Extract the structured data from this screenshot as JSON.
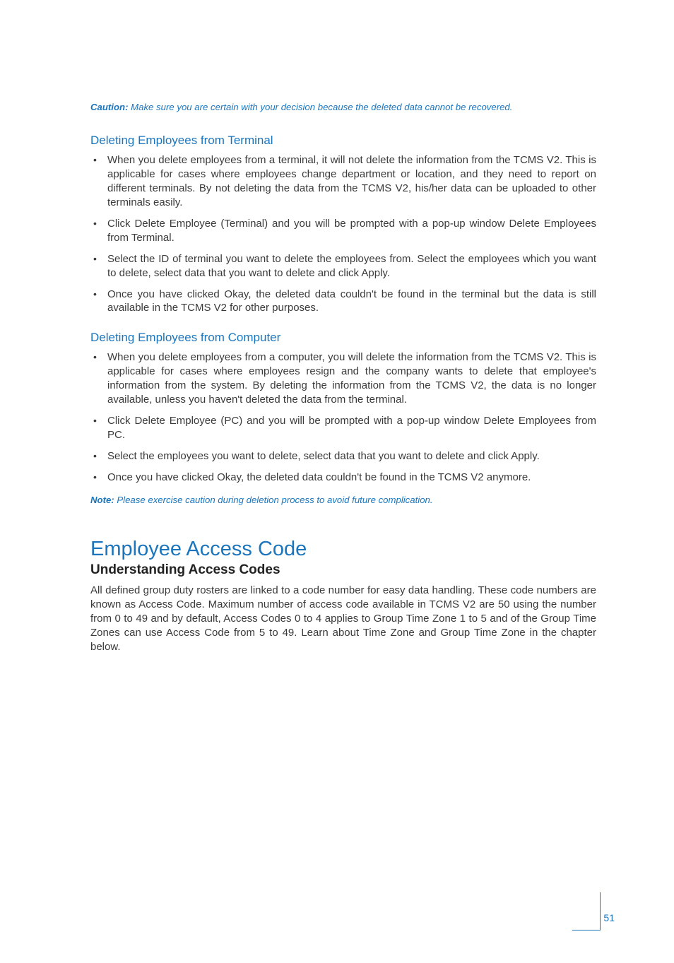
{
  "caution": {
    "label": "Caution:",
    "text": " Make sure you are certain with your decision because the deleted data cannot be recovered."
  },
  "section1": {
    "title": "Deleting Employees from Terminal",
    "items": [
      "When you delete employees from a terminal, it will not delete the information from the TCMS V2. This is applicable for cases where employees change department or location, and they need to report on different terminals. By not deleting the data from the TCMS V2, his/her data can be uploaded to other terminals easily.",
      "Click Delete Employee (Terminal) and you will be prompted with a pop-up window Delete Employees from Terminal.",
      "Select the ID of terminal you want to delete the employees from. Select the employees which you want to delete, select data that you want to delete and click Apply.",
      "Once you have clicked Okay, the deleted data couldn't be found in the terminal but the data is still available in the TCMS V2 for other purposes."
    ]
  },
  "section2": {
    "title": "Deleting Employees from Computer",
    "items": [
      "When you delete employees from a computer, you will delete the information from the TCMS V2. This is applicable for cases where employees resign and the company wants to delete that employee's information from the system. By deleting the information from the TCMS V2, the data is no longer available, unless you haven't deleted the data from the terminal.",
      "Click Delete Employee (PC) and you will be prompted with a pop-up window Delete Employees from PC.",
      "Select the employees you want to delete, select data that you want to delete and click Apply.",
      "Once you have clicked Okay, the deleted data couldn't be found in the TCMS V2 anymore."
    ]
  },
  "note": {
    "label": "Note:",
    "text": " Please exercise caution during deletion process to avoid future complication."
  },
  "main": {
    "h1": "Employee Access Code",
    "h2": "Understanding Access Codes",
    "para": "All defined group duty rosters are linked to a code number for easy data handling. These code numbers are known as Access Code. Maximum number of access code available in TCMS V2 are 50 using the number from 0 to 49 and by default, Access Codes 0 to 4 applies to Group Time Zone 1 to 5 and of the Group Time Zones can use Access Code from 5 to 49.   Learn about Time Zone and Group Time Zone in the chapter below."
  },
  "page": "51"
}
